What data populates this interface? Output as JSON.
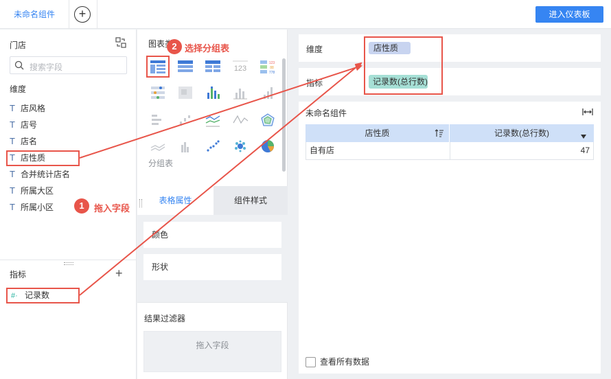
{
  "topbar": {
    "tab_label": "未命名组件",
    "add_tab_glyph": "+",
    "enter_dashboard": "进入仪表板"
  },
  "fields_panel": {
    "dataset_title": "门店",
    "search_placeholder": "搜索字段",
    "dimensions_label": "维度",
    "dimensions": [
      {
        "type": "T",
        "name": "店风格"
      },
      {
        "type": "T",
        "name": "店号"
      },
      {
        "type": "T",
        "name": "店名"
      },
      {
        "type": "T",
        "name": "店性质"
      },
      {
        "type": "T",
        "name": "合并统计店名"
      },
      {
        "type": "T",
        "name": "所属大区"
      },
      {
        "type": "T",
        "name": "所属小区"
      }
    ],
    "metrics_label": "指标",
    "add_metric_glyph": "+",
    "metrics": [
      {
        "type": "#·",
        "name": "记录数"
      }
    ]
  },
  "chart_panel": {
    "title": "图表类",
    "hovered_chart_name": "分组表",
    "property_tabs": [
      {
        "label": "表格属性",
        "active": true
      },
      {
        "label": "组件样式",
        "active": false
      }
    ],
    "properties": [
      "颜色",
      "形状"
    ],
    "filter_title": "结果过滤器",
    "filter_placeholder": "拖入字段"
  },
  "config": {
    "dimension_label": "维度",
    "dimension_value": "店性质",
    "metric_label": "指标",
    "metric_value": "记录数(总行数)"
  },
  "preview": {
    "title": "未命名组件",
    "columns": [
      "店性质",
      "记录数(总行数)"
    ],
    "rows": [
      {
        "c1": "自有店",
        "c2": "47"
      }
    ],
    "view_all_label": "查看所有数据"
  },
  "annotations": {
    "step1_number": "1",
    "step1_text": "拖入字段",
    "step2_number": "2",
    "step2_text": "选择分组表",
    "color": "#e8554a"
  },
  "colors": {
    "accent": "#3685f2",
    "dimension_pill": "#c8d4f0",
    "metric_pill": "#a6e0d6",
    "table_header": "#cfe0f8"
  }
}
